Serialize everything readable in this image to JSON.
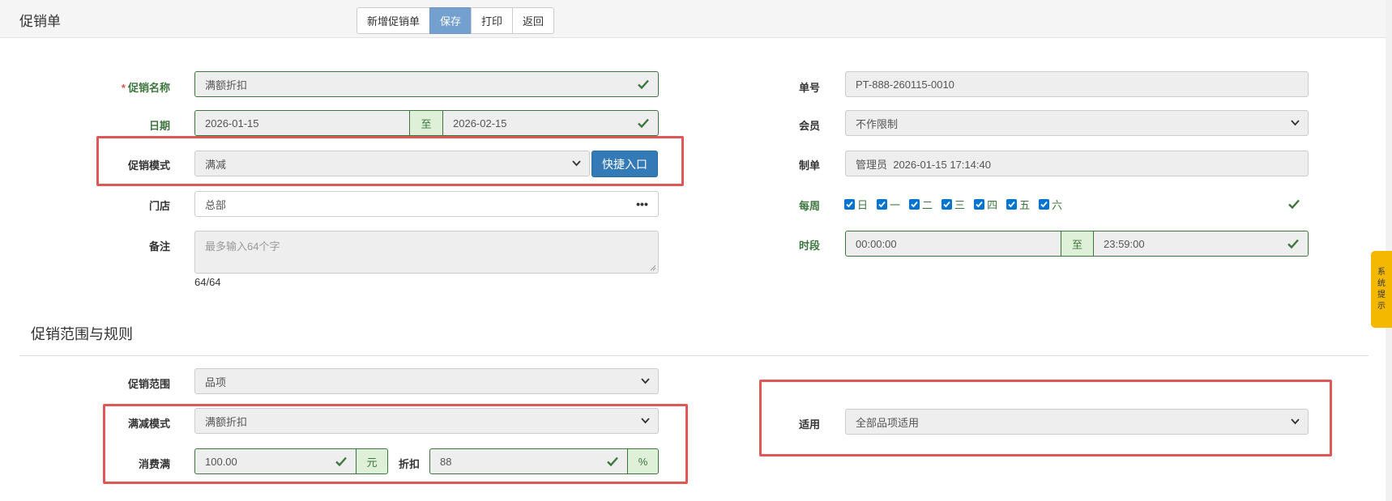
{
  "header": {
    "title": "促销单",
    "buttons": {
      "new": "新增促销单",
      "save": "保存",
      "print": "打印",
      "back": "返回"
    }
  },
  "form": {
    "name": {
      "label": "促销名称",
      "required_mark": "*",
      "value": "满额折扣"
    },
    "date": {
      "label": "日期",
      "start": "2026-01-15",
      "separator": "至",
      "end": "2026-02-15"
    },
    "mode": {
      "label": "促销模式",
      "value": "满减",
      "quick_button": "快捷入口"
    },
    "store": {
      "label": "门店",
      "value": "总部",
      "more": "•••"
    },
    "remark": {
      "label": "备注",
      "placeholder": "最多输入64个字",
      "counter": "64/64"
    },
    "doc_no": {
      "label": "单号",
      "value": "PT-888-260115-0010"
    },
    "member": {
      "label": "会员",
      "value": "不作限制"
    },
    "creator": {
      "label": "制单",
      "value": "管理员  2026-01-15 17:14:40"
    },
    "weekly": {
      "label": "每周",
      "days": [
        "日",
        "一",
        "二",
        "三",
        "四",
        "五",
        "六"
      ]
    },
    "time": {
      "label": "时段",
      "start": "00:00:00",
      "separator": "至",
      "end": "23:59:00"
    }
  },
  "rules": {
    "section_title": "促销范围与规则",
    "scope": {
      "label": "促销范围",
      "value": "品项"
    },
    "reduce_mode": {
      "label": "满减模式",
      "value": "满额折扣"
    },
    "spend": {
      "label": "消费满",
      "value": "100.00",
      "unit": "元"
    },
    "discount": {
      "label": "折扣",
      "value": "88",
      "unit": "%"
    },
    "applies": {
      "label": "适用",
      "value": "全部品项适用"
    }
  },
  "side_tab": {
    "chars": [
      "系",
      "统",
      "提",
      "示"
    ]
  },
  "colors": {
    "success": "#3c763d",
    "primary": "#337ab7",
    "highlight": "#e05757",
    "tab": "#f5b800"
  }
}
